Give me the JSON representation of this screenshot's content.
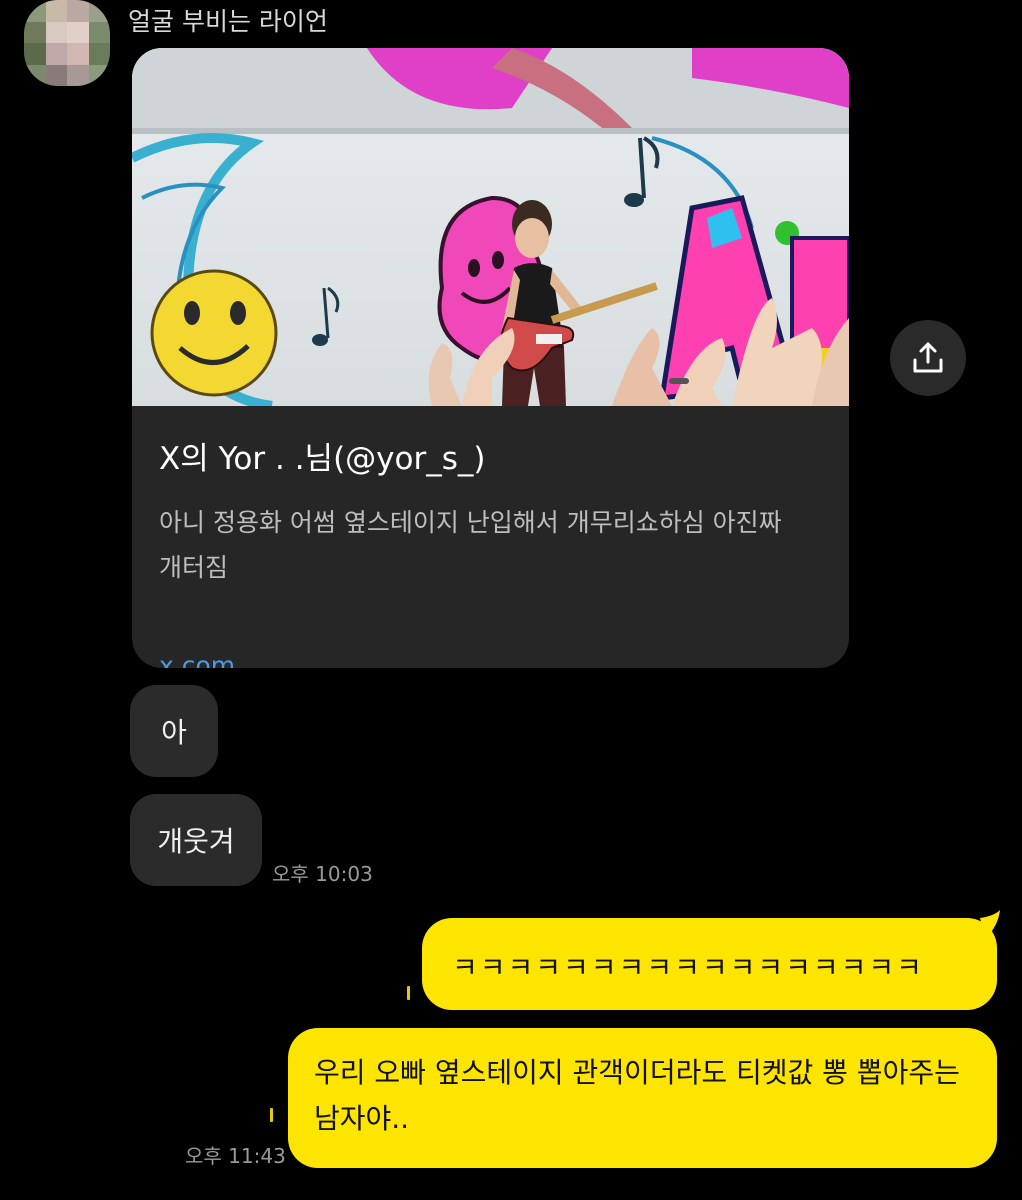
{
  "sender": {
    "name": "얼굴 부비는 라이언"
  },
  "link_card": {
    "title": "X의 Yor . .님(@yor_s_)",
    "description": "아니 정용화 어썸 옆스테이지 난입해서 개무리쇼하심 아진짜개터짐",
    "domain": "x.com"
  },
  "share_button": {
    "icon": "share-icon"
  },
  "incoming": [
    {
      "text": "아"
    },
    {
      "text": "개웃겨"
    }
  ],
  "incoming_time": "오후 10:03",
  "outgoing": [
    {
      "text": "ㅋㅋㅋㅋㅋㅋㅋㅋㅋㅋㅋㅋㅋㅋㅋㅋㅋ"
    },
    {
      "text": "우리 오빠 옆스테이지 관객이더라도 티켓값 뽕 뽑아주는 남자야.."
    }
  ],
  "outgoing_time": "오후 11:43",
  "colors": {
    "background": "#000000",
    "outgoing_bubble": "#fee500",
    "incoming_bubble": "#2b2b2b",
    "link": "#4a9ae8"
  }
}
